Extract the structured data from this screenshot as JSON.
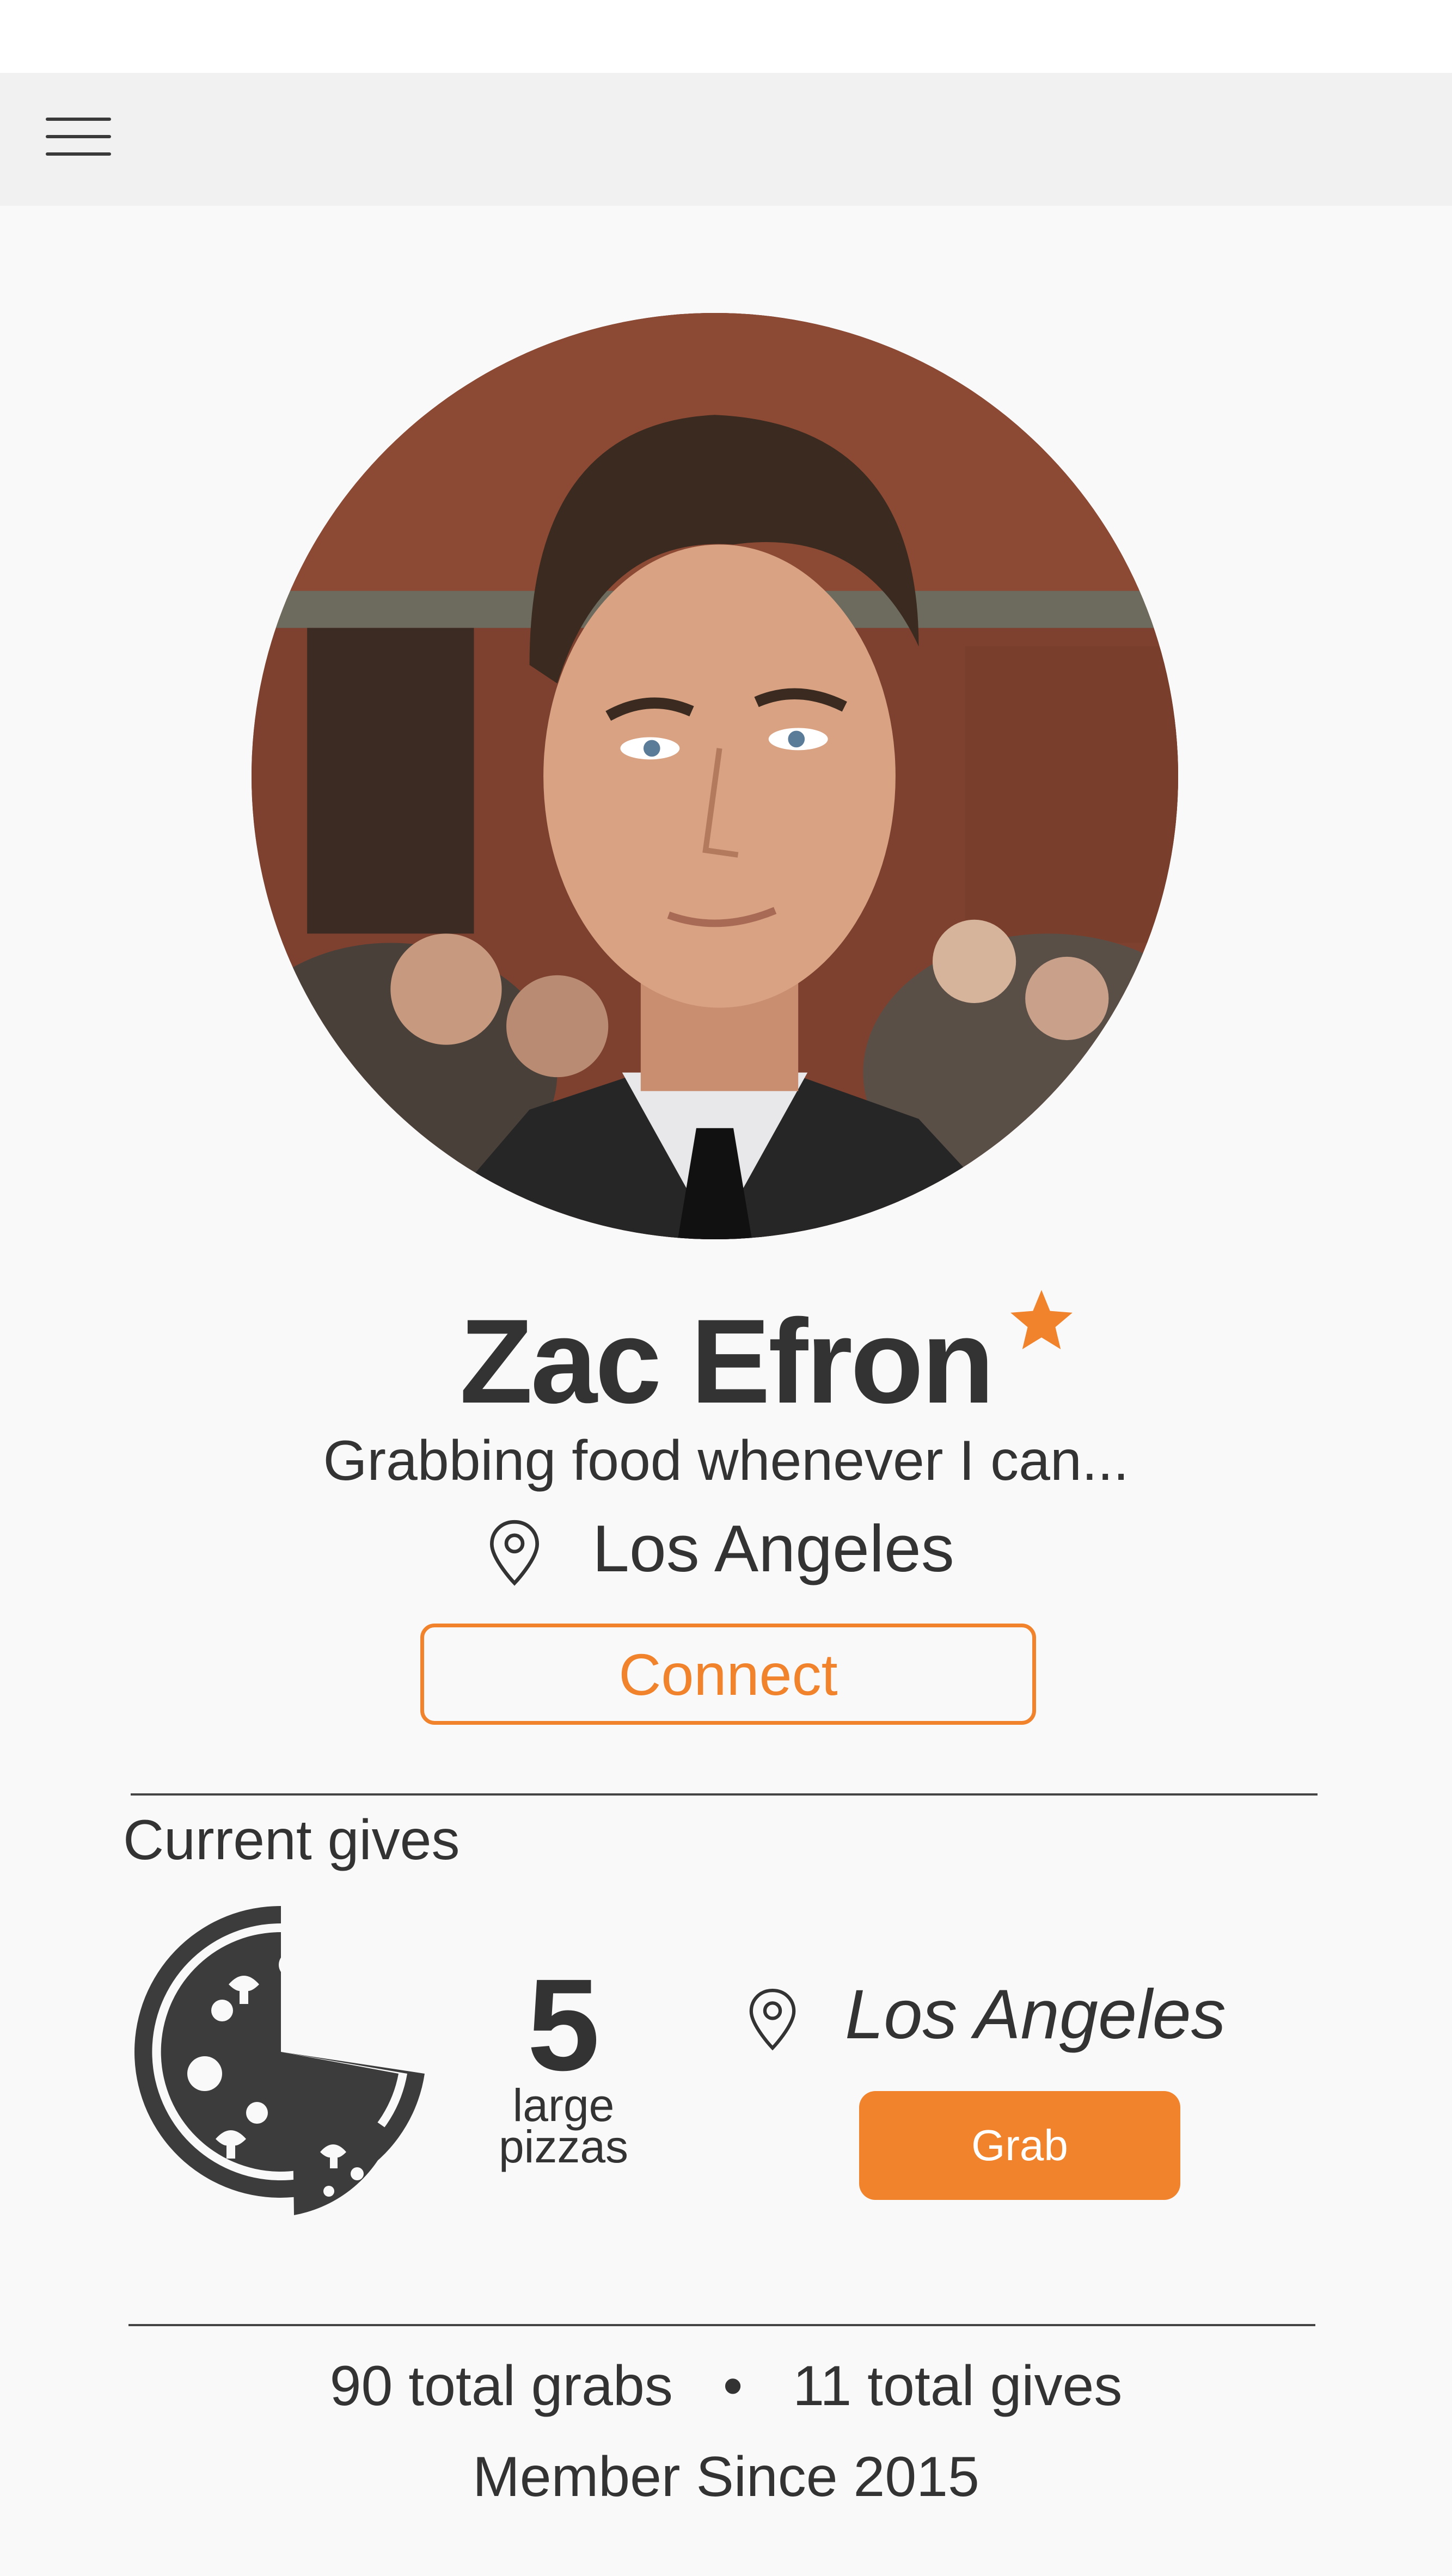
{
  "profile": {
    "name": "Zac Efron",
    "tagline": "Grabbing food whenever I can...",
    "location": "Los Angeles",
    "connect_label": "Connect",
    "featured": true
  },
  "current_gives": {
    "title": "Current gives",
    "items": [
      {
        "quantity": "5",
        "unit_line1": "large",
        "unit_line2": "pizzas",
        "location": "Los Angeles",
        "action_label": "Grab",
        "icon": "pizza-icon"
      }
    ]
  },
  "stats": {
    "total_grabs": "90 total grabs",
    "separator": "•",
    "total_gives": "11 total gives",
    "member_since": "Member Since 2015"
  },
  "nav": {
    "menu_icon": "hamburger-menu-icon"
  },
  "colors": {
    "accent": "#f0832b",
    "text": "#333333",
    "navbar": "#f1f1f1",
    "background": "#f9f9f9"
  }
}
